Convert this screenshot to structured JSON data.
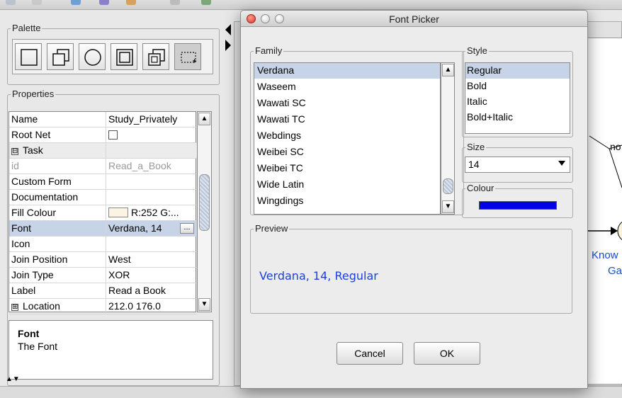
{
  "dialog": {
    "title": "Font Picker",
    "family_label": "Family",
    "families": [
      "Verdana",
      "Waseem",
      "Wawati SC",
      "Wawati TC",
      "Webdings",
      "Weibei SC",
      "Weibei TC",
      "Wide Latin",
      "Wingdings"
    ],
    "family_selected": "Verdana",
    "style_label": "Style",
    "styles": [
      "Regular",
      "Bold",
      "Italic",
      "Bold+Italic"
    ],
    "style_selected": "Regular",
    "size_label": "Size",
    "size_value": "14",
    "colour_label": "Colour",
    "colour_value": "#0000e6",
    "preview_label": "Preview",
    "preview_text": "Verdana, 14, Regular",
    "cancel_label": "Cancel",
    "ok_label": "OK"
  },
  "palette": {
    "title": "Palette"
  },
  "properties": {
    "title": "Properties",
    "rows": [
      {
        "key": "Name",
        "value": "Study_Privately"
      },
      {
        "key": "Root Net",
        "value": ""
      },
      {
        "key": "Task",
        "value": ""
      },
      {
        "key": "id",
        "value": "Read_a_Book"
      },
      {
        "key": "Custom Form",
        "value": ""
      },
      {
        "key": "Documentation",
        "value": ""
      },
      {
        "key": "Fill Colour",
        "value": "R:252 G:..."
      },
      {
        "key": "Font",
        "value": "Verdana, 14"
      },
      {
        "key": "Icon",
        "value": ""
      },
      {
        "key": "Join Position",
        "value": "West"
      },
      {
        "key": "Join Type",
        "value": "XOR"
      },
      {
        "key": "Label",
        "value": "Read a Book"
      },
      {
        "key": "Location",
        "value": "212.0 176.0"
      }
    ],
    "expand_minus": "⊟",
    "expand_plus": "⊞",
    "font_button_label": "..."
  },
  "help": {
    "title": "Font",
    "text": "The Font"
  },
  "canvas": {
    "text1": "no",
    "text2": "Know",
    "text3": "Gai"
  }
}
